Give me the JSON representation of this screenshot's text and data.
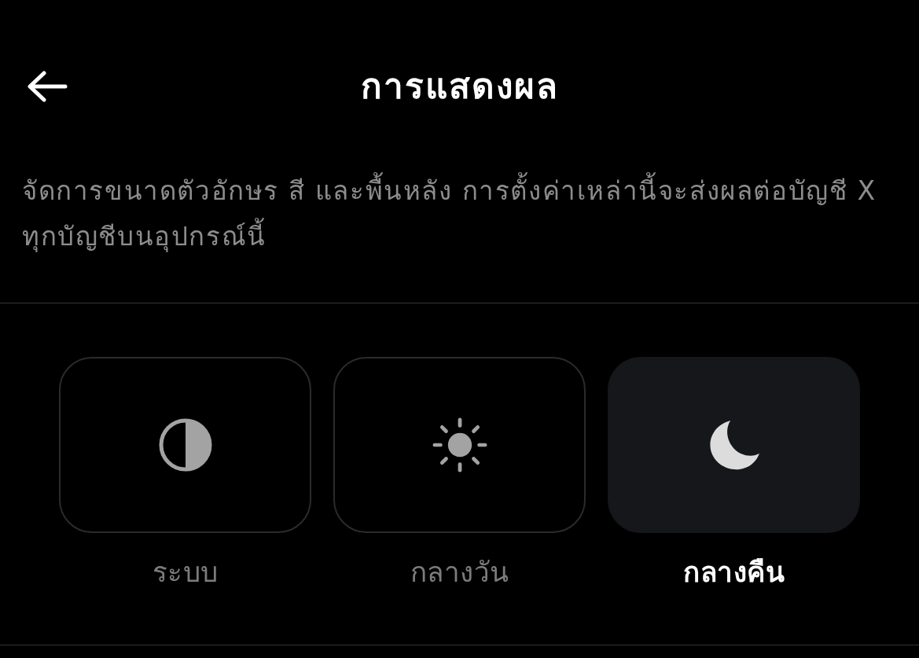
{
  "header": {
    "title": "การแสดงผล"
  },
  "description": "จัดการขนาดตัวอักษร สี และพื้นหลัง การตั้งค่าเหล่านี้จะส่งผลต่อบัญชี X ทุกบัญชีบนอุปกรณ์นี้",
  "themes": [
    {
      "kind": "system",
      "label": "ระบบ",
      "selected": false
    },
    {
      "kind": "light",
      "label": "กลางวัน",
      "selected": false
    },
    {
      "kind": "dark",
      "label": "กลางคืน",
      "selected": true
    }
  ]
}
